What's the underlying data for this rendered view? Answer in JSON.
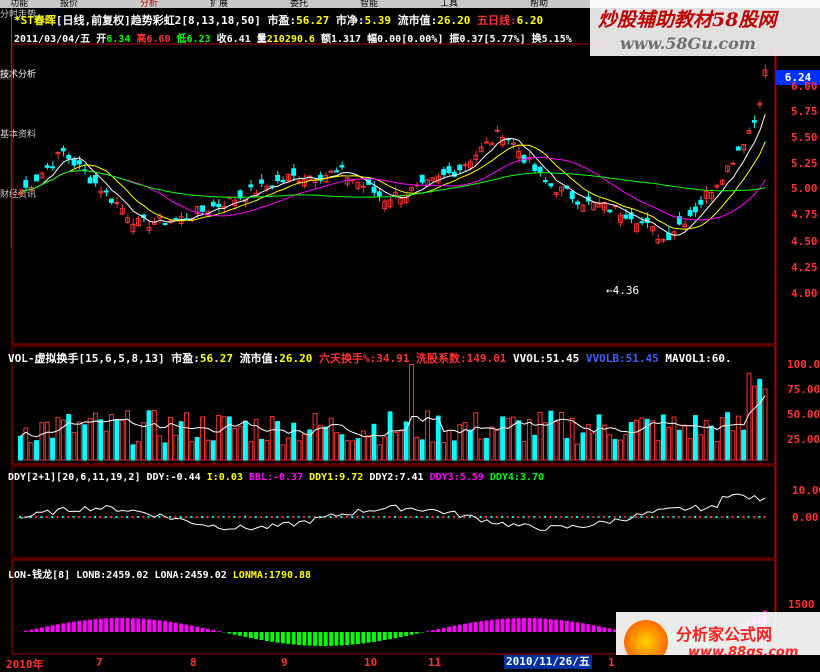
{
  "menu": [
    "功能",
    "报价",
    "分析",
    "扩展",
    "委托",
    "智能",
    "工具",
    "帮助"
  ],
  "sidebar": [
    "分时走势",
    "技术分析",
    "基本资料",
    "财经资讯"
  ],
  "header1": {
    "name": "*ST春晖",
    "cycle": "[日线,前复权]",
    "ind": "趋势彩虹2",
    "params": "[8,13,18,50]",
    "pe_l": "市盈:",
    "pe": "56.27",
    "pb_l": "市净:",
    "pb": "5.39",
    "mv_l": "流市值:",
    "mv": "26.20",
    "ma5_l": "五日线:",
    "ma5": "6.20"
  },
  "header2": {
    "date": "2011/03/04/五",
    "open_l": "开",
    "open": "6.34",
    "high_l": "高",
    "high": "6.60",
    "low_l": "低",
    "low": "6.23",
    "close_l": "收",
    "close": "6.41",
    "vol_l": "量",
    "vol": "210290.6",
    "amt_l": "额",
    "amt": "1.317",
    "chg_l": "幅",
    "chg": "0.00[0.00%]",
    "amp_l": "振",
    "amp": "0.37[5.77%]",
    "turn_l": "换",
    "turn": "5.15%"
  },
  "watermark": {
    "top_cn": "炒股辅助教材58股网",
    "top_url": "www.58Gu.com",
    "bottom_cn": "分析家公式网",
    "bottom_url": "www.88gs.com"
  },
  "price_axis": [
    "6.00",
    "5.75",
    "5.50",
    "5.25",
    "5.00",
    "4.75",
    "4.50",
    "4.25",
    "4.00"
  ],
  "price_tag": "6.24",
  "low_label": "4.36",
  "vol_header": {
    "name": "VOL-虚拟换手",
    "params": "[15,6,5,8,13]",
    "pe_l": "市盈:",
    "pe": "56.27",
    "mv_l": "流市值:",
    "mv": "26.20",
    "six_l": "六天换手%:",
    "six": "34.91",
    "wash_l": "洗股系数:",
    "wash": "149.01",
    "vvol_l": "VVOL:",
    "vvol": "51.45",
    "vvolb_l": "VVOLB:",
    "vvolb": "51.45",
    "mavol_l": "MAVOL1:",
    "mavol": "60."
  },
  "vol_axis": [
    "100.0",
    "75.00",
    "50.00",
    "25.00"
  ],
  "ddy_header": {
    "name": "DDY[2+1]",
    "params": "[20,6,11,19,2]",
    "ddy_l": "DDY:",
    "ddy": "-0.44",
    "i_l": "I:",
    "i": "0.03",
    "bbl_l": "BBL:",
    "bbl": "-0.37",
    "ddy1_l": "DDY1:",
    "ddy1": "9.72",
    "ddy2_l": "DDY2:",
    "ddy2": "7.41",
    "ddy3_l": "DDY3:",
    "ddy3": "5.59",
    "ddy4_l": "DDY4:",
    "ddy4": "3.70"
  },
  "ddy_axis": [
    "10.00",
    "0.00"
  ],
  "lon_header": {
    "name": "LON-钱龙",
    "params": "[8]",
    "lonb_l": "LONB:",
    "lonb": "2459.02",
    "lona_l": "LONA:",
    "lona": "2459.02",
    "lonma_l": "LONMA:",
    "lonma": "1790.88"
  },
  "lon_axis": [
    "1500"
  ],
  "dates": [
    "2010年",
    "7",
    "8",
    "9",
    "10",
    "11",
    "1"
  ],
  "current_date": "2010/11/26/五",
  "colors": {
    "up": "#ff3030",
    "down": "#00ffff",
    "ma1": "#ffffff",
    "ma2": "#ffff00",
    "ma3": "#ff00ff",
    "ma4": "#00ff00",
    "border": "#b00000"
  }
}
